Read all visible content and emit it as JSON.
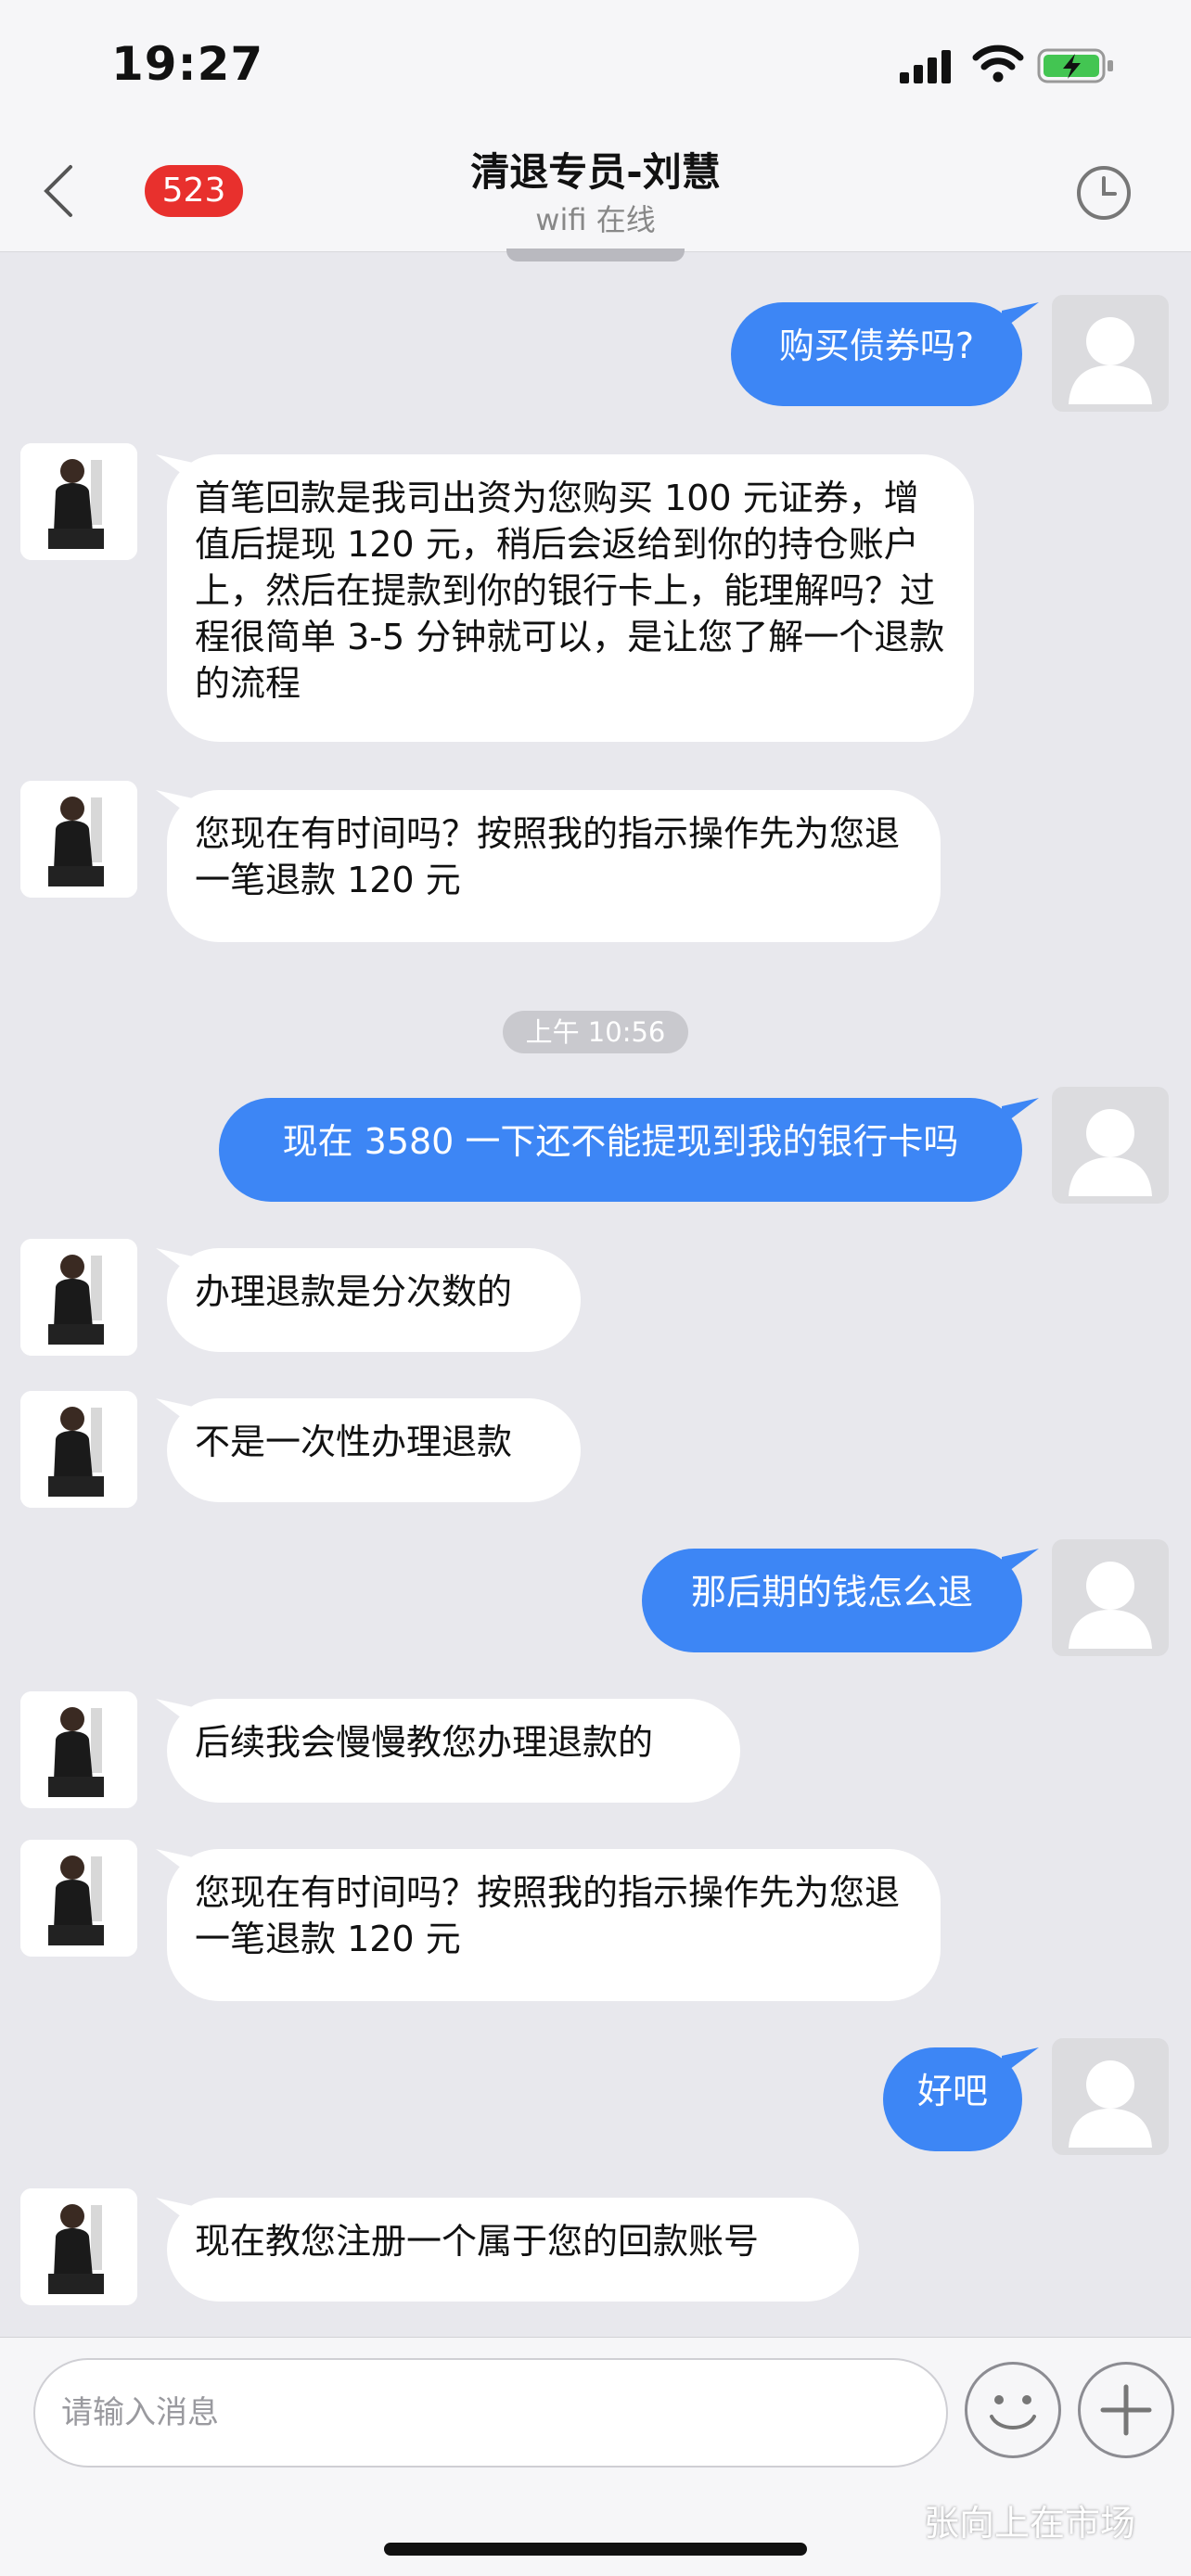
{
  "status_bar": {
    "time": "19:27"
  },
  "nav": {
    "badge_count": "523",
    "title": "清退专员-刘慧",
    "subtitle": "wifi 在线"
  },
  "messages": [
    {
      "from": "me",
      "text": "购买债券吗?"
    },
    {
      "from": "them",
      "text": "首笔回款是我司出资为您购买 100 元证券，增值后提现 120 元，稍后会返给到你的持仓账户上，然后在提款到你的银行卡上，能理解吗？过程很简单 3-5 分钟就可以，是让您了解一个退款的流程"
    },
    {
      "from": "them",
      "text": "您现在有时间吗？按照我的指示操作先为您退一笔退款 120 元"
    },
    {
      "from": "me",
      "text": "现在 3580 一下还不能提现到我的银行卡吗"
    },
    {
      "from": "them",
      "text": "办理退款是分次数的"
    },
    {
      "from": "them",
      "text": "不是一次性办理退款"
    },
    {
      "from": "me",
      "text": "那后期的钱怎么退"
    },
    {
      "from": "them",
      "text": "后续我会慢慢教您办理退款的"
    },
    {
      "from": "them",
      "text": "您现在有时间吗？按照我的指示操作先为您退一笔退款 120 元"
    },
    {
      "from": "me",
      "text": "好吧"
    },
    {
      "from": "them",
      "text": "现在教您注册一个属于您的回款账号"
    }
  ],
  "timestamp": "上午 10:56",
  "composer": {
    "placeholder": "请输入消息"
  },
  "watermark": "张向上在市场",
  "colors": {
    "outgoing_bubble": "#3d86f5",
    "incoming_bubble": "#ffffff",
    "badge": "#e8302d",
    "background": "#e8e8ed"
  },
  "icons": [
    "back-chevron-icon",
    "clock-icon",
    "emoji-icon",
    "plus-icon",
    "signal-icon",
    "wifi-icon",
    "battery-charging-icon"
  ]
}
